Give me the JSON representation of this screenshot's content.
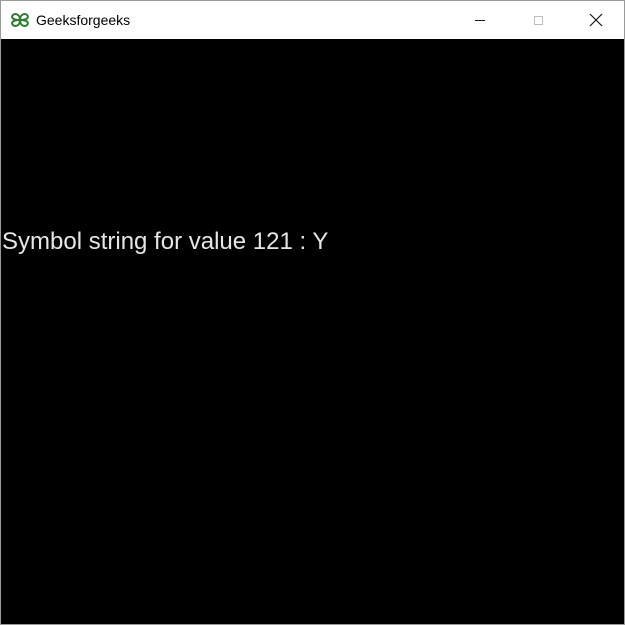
{
  "window": {
    "title": "Geeksforgeeks",
    "app_icon": "geeksforgeeks-logo-icon",
    "controls": {
      "minimize_icon": "minimize-icon",
      "maximize_icon": "maximize-icon",
      "close_icon": "close-icon"
    }
  },
  "content": {
    "message": "Symbol string for value 121 : Y"
  },
  "colors": {
    "title_bar": "#ffffff",
    "client_background": "#000000",
    "text": "#e6e6e6",
    "logo": "#2f7d32"
  }
}
